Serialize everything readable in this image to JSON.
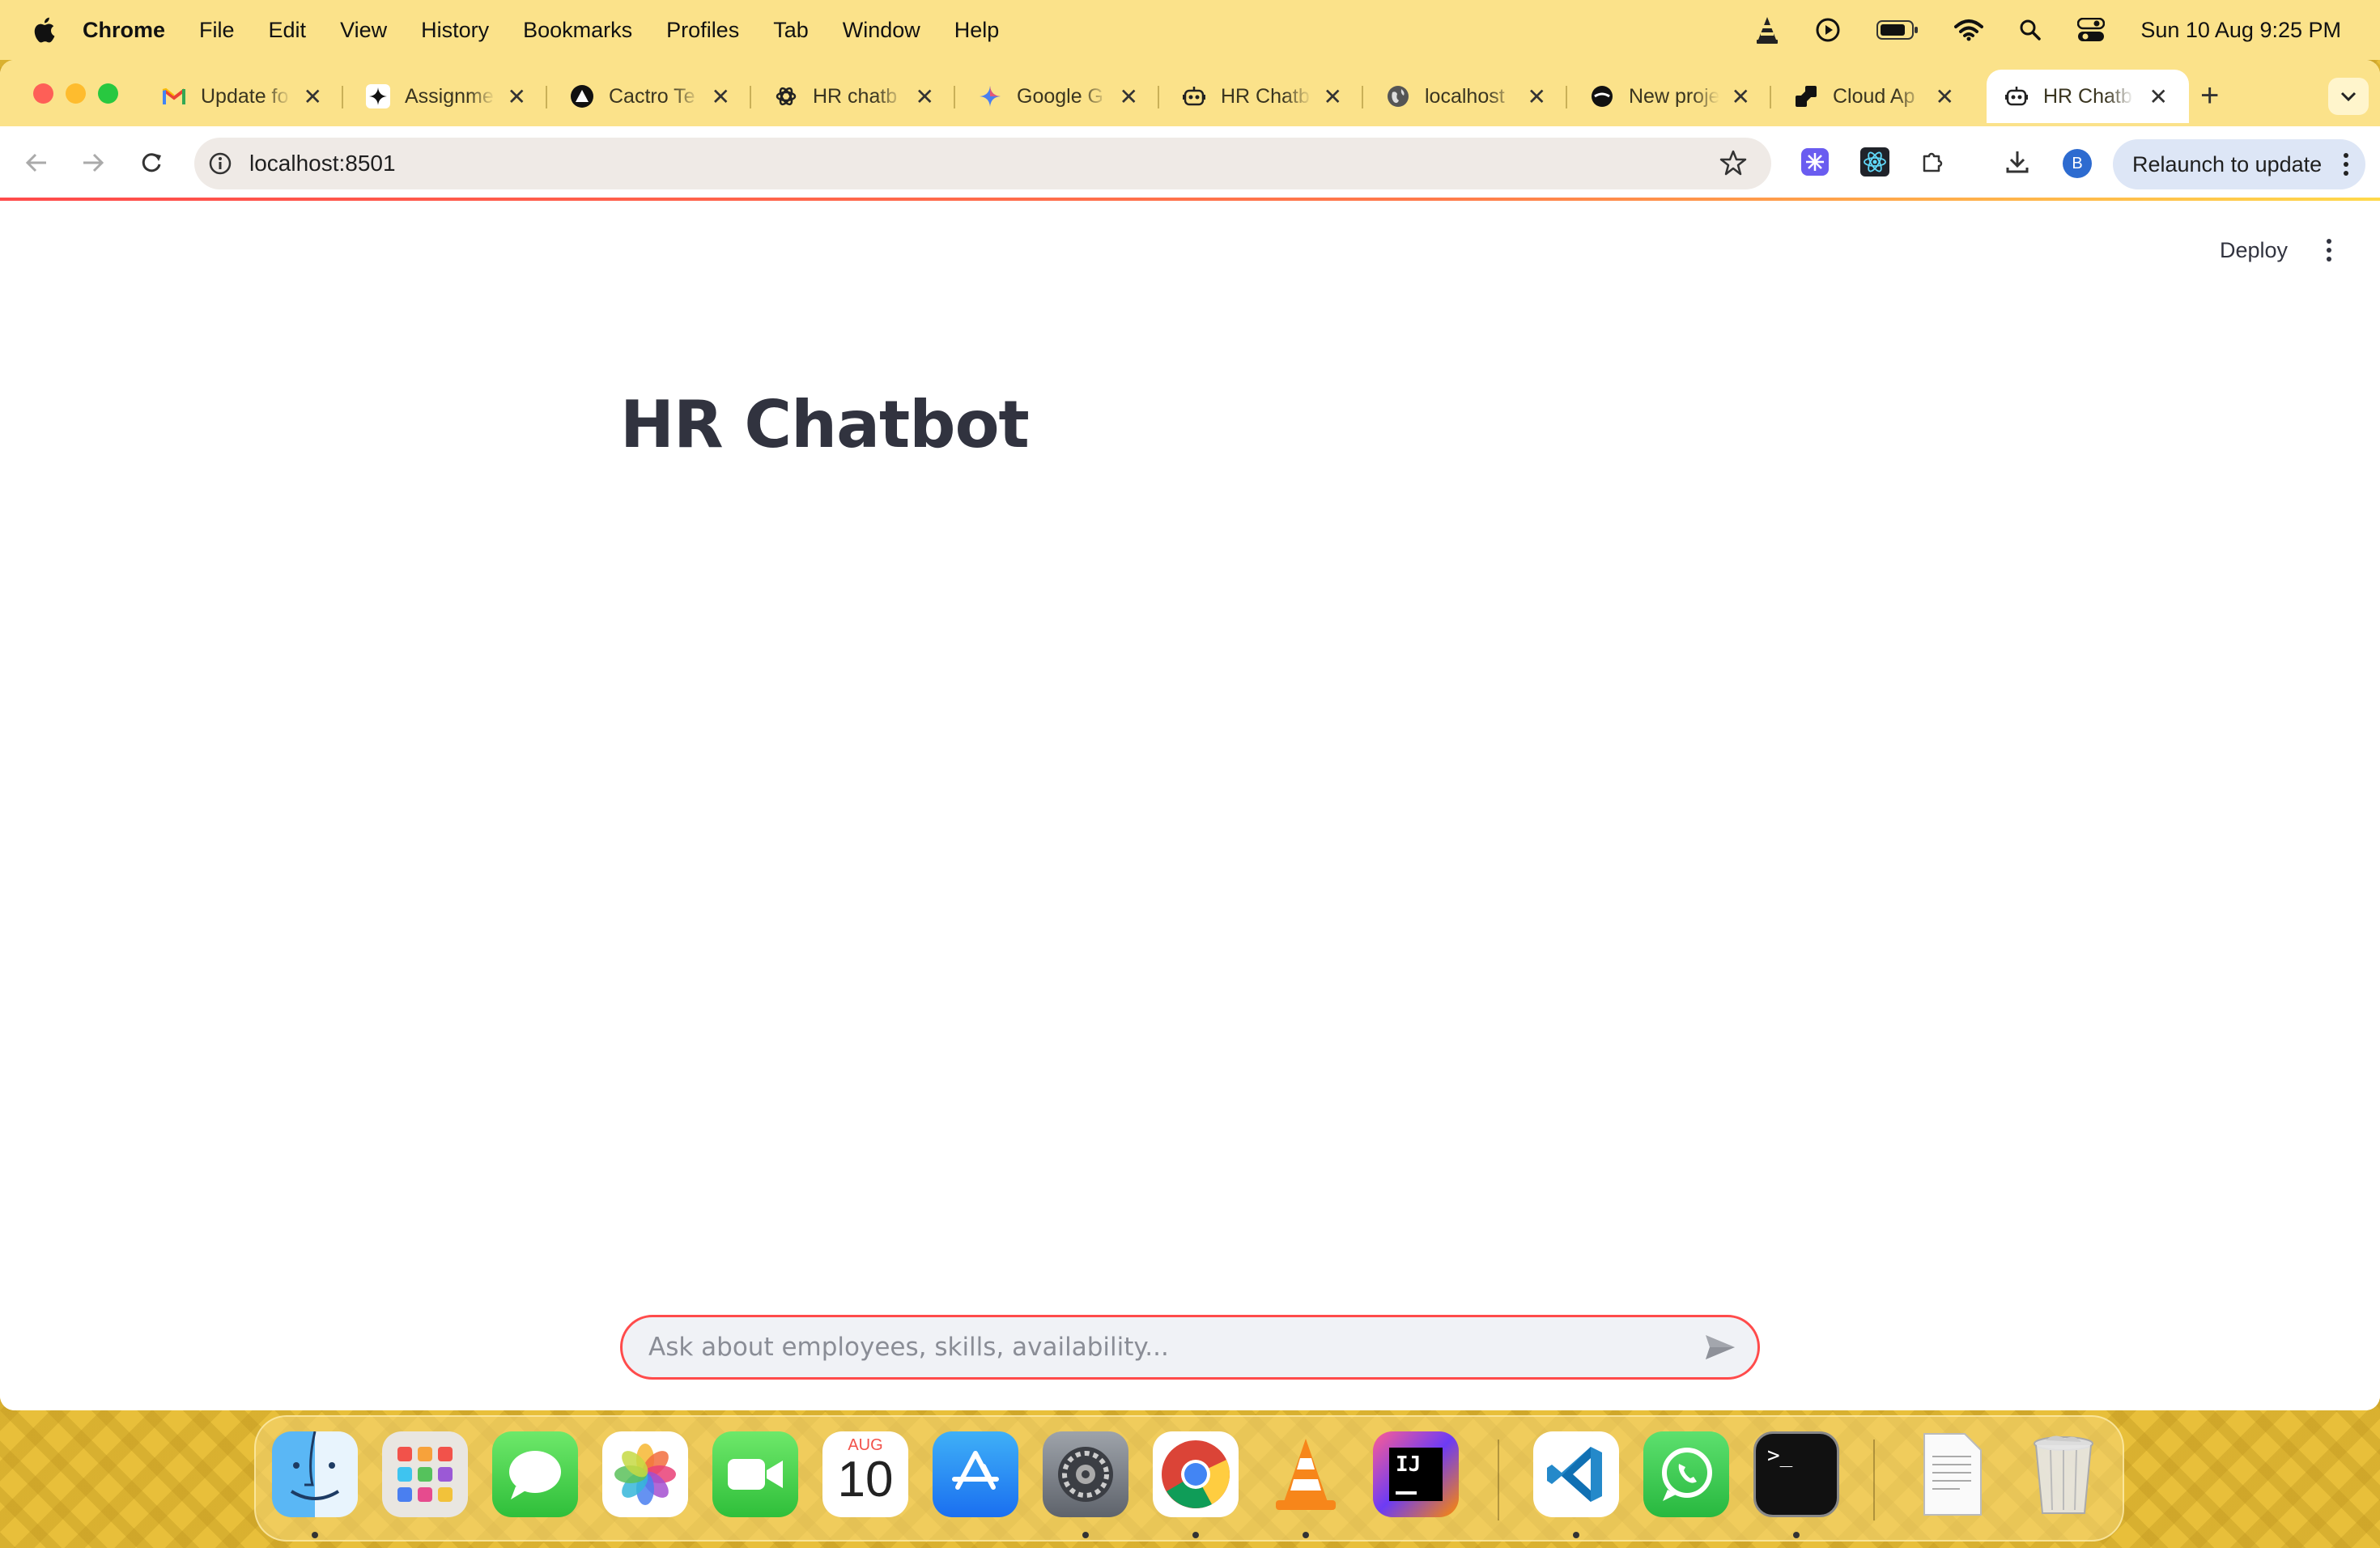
{
  "menubar": {
    "app_name": "Chrome",
    "items": [
      "File",
      "Edit",
      "View",
      "History",
      "Bookmarks",
      "Profiles",
      "Tab",
      "Window",
      "Help"
    ],
    "status_icons": [
      "vlc-cone-icon",
      "play-circle-icon",
      "battery-icon",
      "wifi-icon",
      "search-icon",
      "control-center-icon"
    ],
    "clock": "Sun 10 Aug  9:25 PM"
  },
  "tabs": [
    {
      "title": "Update fo",
      "icon": "gmail-icon"
    },
    {
      "title": "Assignme",
      "icon": "sparkle-icon"
    },
    {
      "title": "Cactro Te",
      "icon": "triangle-logo-icon"
    },
    {
      "title": "HR chatb",
      "icon": "openai-icon"
    },
    {
      "title": "Google G",
      "icon": "gemini-icon"
    },
    {
      "title": "HR Chatb",
      "icon": "robot-icon"
    },
    {
      "title": "localhost",
      "icon": "globe-icon"
    },
    {
      "title": "New proje",
      "icon": "circle-logo-icon"
    },
    {
      "title": "Cloud Ap",
      "icon": "cloud-app-icon"
    },
    {
      "title": "HR Chatb",
      "icon": "robot-icon",
      "active": true
    }
  ],
  "toolbar": {
    "url": "localhost:8501",
    "profile_initial": "B",
    "relaunch_label": "Relaunch to update"
  },
  "page": {
    "deploy_label": "Deploy",
    "title": "HR Chatbot",
    "chat_placeholder": "Ask about employees, skills, availability..."
  },
  "calendar_icon": {
    "month": "AUG",
    "day": "10"
  },
  "dock_apps": [
    "Finder",
    "Launchpad",
    "Messages",
    "Photos",
    "FaceTime",
    "Calendar",
    "App Store",
    "System Settings",
    "Google Chrome",
    "VLC",
    "IntelliJ IDEA",
    "Visual Studio Code",
    "WhatsApp",
    "Terminal",
    "Document",
    "Trash"
  ],
  "colors": {
    "accent": "#ff4b4b",
    "menubar_bg": "#fbe28a",
    "text": "#31333f"
  }
}
